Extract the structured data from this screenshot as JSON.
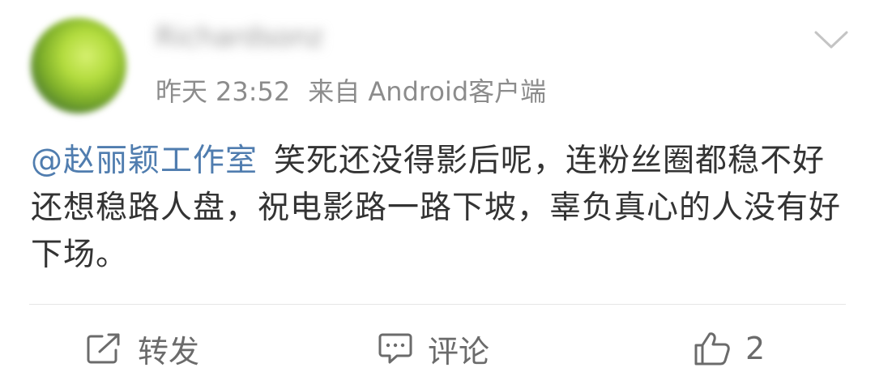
{
  "post": {
    "username": "Richardsonz",
    "time_prefix": "昨天",
    "time": "23:52",
    "source": "来自 Android客户端",
    "mention": "@赵丽颖工作室",
    "body": "笑死还没得影后呢，连粉丝圈都稳不好还想稳路人盘，祝电影路一路下坡，辜负真心的人没有好下场。"
  },
  "actions": {
    "repost_label": "转发",
    "comment_label": "评论",
    "like_count": "2"
  },
  "icons": {
    "repost": "share-out-icon",
    "comment": "comment-bubble-icon",
    "like": "thumbs-up-icon",
    "menu": "chevron-down-icon"
  },
  "colors": {
    "mention": "#507daf",
    "meta": "#8c8c8c",
    "text": "#333333",
    "icon": "#6b6b6b"
  }
}
